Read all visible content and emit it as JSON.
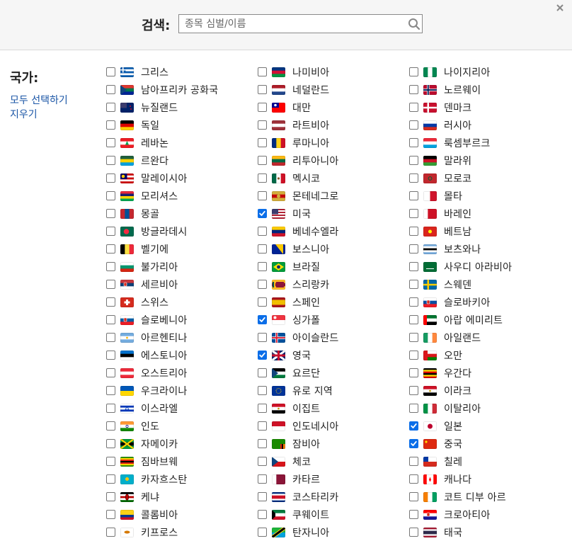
{
  "search": {
    "label": "검색:",
    "placeholder": "종목 심벌/이름",
    "value": ""
  },
  "country_panel": {
    "title": "국가:",
    "select_all": "모두 선택하기",
    "clear": "지우기"
  },
  "columns": [
    [
      {
        "name": "그리스",
        "checked": false,
        "flag": "greece"
      },
      {
        "name": "남아프리카 공화국",
        "checked": false,
        "flag": "south-africa"
      },
      {
        "name": "뉴질랜드",
        "checked": false,
        "flag": "new-zealand"
      },
      {
        "name": "독일",
        "checked": false,
        "flag": "germany"
      },
      {
        "name": "레바논",
        "checked": false,
        "flag": "lebanon"
      },
      {
        "name": "르완다",
        "checked": false,
        "flag": "rwanda"
      },
      {
        "name": "말레이시아",
        "checked": false,
        "flag": "malaysia"
      },
      {
        "name": "모리셔스",
        "checked": false,
        "flag": "mauritius"
      },
      {
        "name": "몽골",
        "checked": false,
        "flag": "mongolia"
      },
      {
        "name": "방글라데시",
        "checked": false,
        "flag": "bangladesh"
      },
      {
        "name": "벨기에",
        "checked": false,
        "flag": "belgium"
      },
      {
        "name": "불가리아",
        "checked": false,
        "flag": "bulgaria"
      },
      {
        "name": "세르비아",
        "checked": false,
        "flag": "serbia"
      },
      {
        "name": "스위스",
        "checked": false,
        "flag": "switzerland"
      },
      {
        "name": "슬로베니아",
        "checked": false,
        "flag": "slovenia"
      },
      {
        "name": "아르헨티나",
        "checked": false,
        "flag": "argentina"
      },
      {
        "name": "에스토니아",
        "checked": false,
        "flag": "estonia"
      },
      {
        "name": "오스트리아",
        "checked": false,
        "flag": "austria"
      },
      {
        "name": "우크라이나",
        "checked": false,
        "flag": "ukraine"
      },
      {
        "name": "이스라엘",
        "checked": false,
        "flag": "israel"
      },
      {
        "name": "인도",
        "checked": false,
        "flag": "india"
      },
      {
        "name": "자메이카",
        "checked": false,
        "flag": "jamaica"
      },
      {
        "name": "짐바브웨",
        "checked": false,
        "flag": "zimbabwe"
      },
      {
        "name": "카자흐스탄",
        "checked": false,
        "flag": "kazakhstan"
      },
      {
        "name": "케냐",
        "checked": false,
        "flag": "kenya"
      },
      {
        "name": "콜롬비아",
        "checked": false,
        "flag": "colombia"
      },
      {
        "name": "키프로스",
        "checked": false,
        "flag": "cyprus"
      }
    ],
    [
      {
        "name": "나미비아",
        "checked": false,
        "flag": "namibia"
      },
      {
        "name": "네덜란드",
        "checked": false,
        "flag": "netherlands"
      },
      {
        "name": "대만",
        "checked": false,
        "flag": "taiwan"
      },
      {
        "name": "라트비아",
        "checked": false,
        "flag": "latvia"
      },
      {
        "name": "루마니아",
        "checked": false,
        "flag": "romania"
      },
      {
        "name": "리투아니아",
        "checked": false,
        "flag": "lithuania"
      },
      {
        "name": "멕시코",
        "checked": false,
        "flag": "mexico"
      },
      {
        "name": "몬테네그로",
        "checked": false,
        "flag": "montenegro"
      },
      {
        "name": "미국",
        "checked": true,
        "flag": "usa"
      },
      {
        "name": "베네수엘라",
        "checked": false,
        "flag": "venezuela"
      },
      {
        "name": "보스니아",
        "checked": false,
        "flag": "bosnia"
      },
      {
        "name": "브라질",
        "checked": false,
        "flag": "brazil"
      },
      {
        "name": "스리랑카",
        "checked": false,
        "flag": "sri-lanka"
      },
      {
        "name": "스페인",
        "checked": false,
        "flag": "spain"
      },
      {
        "name": "싱가폴",
        "checked": true,
        "flag": "singapore"
      },
      {
        "name": "아이슬란드",
        "checked": false,
        "flag": "iceland"
      },
      {
        "name": "영국",
        "checked": true,
        "flag": "uk"
      },
      {
        "name": "요르단",
        "checked": false,
        "flag": "jordan"
      },
      {
        "name": "유로 지역",
        "checked": false,
        "flag": "eu"
      },
      {
        "name": "이집트",
        "checked": false,
        "flag": "egypt"
      },
      {
        "name": "인도네시아",
        "checked": false,
        "flag": "indonesia"
      },
      {
        "name": "잠비아",
        "checked": false,
        "flag": "zambia"
      },
      {
        "name": "체코",
        "checked": false,
        "flag": "czech"
      },
      {
        "name": "카타르",
        "checked": false,
        "flag": "qatar"
      },
      {
        "name": "코스타리카",
        "checked": false,
        "flag": "costa-rica"
      },
      {
        "name": "쿠웨이트",
        "checked": false,
        "flag": "kuwait"
      },
      {
        "name": "탄자니아",
        "checked": false,
        "flag": "tanzania"
      }
    ],
    [
      {
        "name": "나이지리아",
        "checked": false,
        "flag": "nigeria"
      },
      {
        "name": "노르웨이",
        "checked": false,
        "flag": "norway"
      },
      {
        "name": "덴마크",
        "checked": false,
        "flag": "denmark"
      },
      {
        "name": "러시아",
        "checked": false,
        "flag": "russia"
      },
      {
        "name": "룩셈부르크",
        "checked": false,
        "flag": "luxembourg"
      },
      {
        "name": "말라위",
        "checked": false,
        "flag": "malawi"
      },
      {
        "name": "모로코",
        "checked": false,
        "flag": "morocco"
      },
      {
        "name": "몰타",
        "checked": false,
        "flag": "malta"
      },
      {
        "name": "바레인",
        "checked": false,
        "flag": "bahrain"
      },
      {
        "name": "베트남",
        "checked": false,
        "flag": "vietnam"
      },
      {
        "name": "보츠와나",
        "checked": false,
        "flag": "botswana"
      },
      {
        "name": "사우디 아라비아",
        "checked": false,
        "flag": "saudi-arabia"
      },
      {
        "name": "스웨덴",
        "checked": false,
        "flag": "sweden"
      },
      {
        "name": "슬로바키아",
        "checked": false,
        "flag": "slovakia"
      },
      {
        "name": "아랍 에미리트",
        "checked": false,
        "flag": "uae"
      },
      {
        "name": "아일랜드",
        "checked": false,
        "flag": "ireland"
      },
      {
        "name": "오만",
        "checked": false,
        "flag": "oman"
      },
      {
        "name": "우간다",
        "checked": false,
        "flag": "uganda"
      },
      {
        "name": "이라크",
        "checked": false,
        "flag": "iraq"
      },
      {
        "name": "이탈리아",
        "checked": false,
        "flag": "italy"
      },
      {
        "name": "일본",
        "checked": true,
        "flag": "japan"
      },
      {
        "name": "중국",
        "checked": true,
        "flag": "china"
      },
      {
        "name": "칠레",
        "checked": false,
        "flag": "chile"
      },
      {
        "name": "캐나다",
        "checked": false,
        "flag": "canada"
      },
      {
        "name": "코트 디부 아르",
        "checked": false,
        "flag": "cote-divoire"
      },
      {
        "name": "크로아티아",
        "checked": false,
        "flag": "croatia"
      },
      {
        "name": "태국",
        "checked": false,
        "flag": "thailand"
      }
    ]
  ],
  "flag_colors": {
    "greece": [
      "h",
      "#0d5eaf",
      "#ffffff",
      "#0d5eaf",
      "#ffffff",
      "#0d5eaf"
    ],
    "south-africa": [
      "h",
      "#de3831",
      "#007a4d",
      "#002395"
    ],
    "new-zealand": [
      "h",
      "#012169",
      "#012169"
    ],
    "germany": [
      "h",
      "#000000",
      "#dd0000",
      "#ffce00"
    ],
    "lebanon": [
      "h",
      "#ed1c24",
      "#ffffff",
      "#ed1c24"
    ],
    "rwanda": [
      "h",
      "#20603d",
      "#fad201",
      "#00a1de"
    ],
    "malaysia": [
      "h",
      "#cc0001",
      "#ffffff",
      "#cc0001",
      "#ffffff",
      "#cc0001"
    ],
    "mauritius": [
      "h",
      "#ea2839",
      "#1a206d",
      "#ffd500",
      "#00a551"
    ],
    "mongolia": [
      "v",
      "#c4272f",
      "#015197",
      "#c4272f"
    ],
    "bangladesh": [
      "h",
      "#006a4e",
      "#006a4e"
    ],
    "belgium": [
      "v",
      "#000000",
      "#fae042",
      "#ed2939"
    ],
    "bulgaria": [
      "h",
      "#ffffff",
      "#00966e",
      "#d62612"
    ],
    "serbia": [
      "h",
      "#c6363c",
      "#0c4076",
      "#ffffff"
    ],
    "switzerland": [
      "h",
      "#d52b1e",
      "#d52b1e"
    ],
    "slovenia": [
      "h",
      "#ffffff",
      "#005da4",
      "#ed1c24"
    ],
    "argentina": [
      "h",
      "#74acdf",
      "#ffffff",
      "#74acdf"
    ],
    "estonia": [
      "h",
      "#0072ce",
      "#000000",
      "#ffffff"
    ],
    "austria": [
      "h",
      "#ed2939",
      "#ffffff",
      "#ed2939"
    ],
    "ukraine": [
      "h",
      "#0057b7",
      "#ffd700"
    ],
    "israel": [
      "h",
      "#ffffff",
      "#0038b8",
      "#ffffff",
      "#0038b8",
      "#ffffff"
    ],
    "india": [
      "h",
      "#ff9933",
      "#ffffff",
      "#138808"
    ],
    "jamaica": [
      "h",
      "#009b3a",
      "#000000",
      "#009b3a"
    ],
    "zimbabwe": [
      "h",
      "#319208",
      "#ffd200",
      "#de2010",
      "#000000",
      "#de2010",
      "#ffd200",
      "#319208"
    ],
    "kazakhstan": [
      "h",
      "#00afca",
      "#00afca"
    ],
    "kenya": [
      "h",
      "#000000",
      "#ffffff",
      "#bb0000",
      "#ffffff",
      "#006600"
    ],
    "colombia": [
      "h",
      "#fcd116",
      "#fcd116",
      "#003893",
      "#ce1126"
    ],
    "cyprus": [
      "h",
      "#ffffff",
      "#ffffff"
    ],
    "namibia": [
      "h",
      "#003580",
      "#d21034",
      "#009543"
    ],
    "netherlands": [
      "h",
      "#ae1c28",
      "#ffffff",
      "#21468b"
    ],
    "taiwan": [
      "h",
      "#fe0000",
      "#fe0000"
    ],
    "latvia": [
      "h",
      "#9e3039",
      "#ffffff",
      "#9e3039"
    ],
    "romania": [
      "v",
      "#002b7f",
      "#fcd116",
      "#ce1126"
    ],
    "lithuania": [
      "h",
      "#fdb913",
      "#006a44",
      "#c1272d"
    ],
    "mexico": [
      "v",
      "#006847",
      "#ffffff",
      "#ce1126"
    ],
    "montenegro": [
      "h",
      "#d3ae3b",
      "#c40308",
      "#d3ae3b"
    ],
    "usa": [
      "h",
      "#b22234",
      "#ffffff",
      "#b22234",
      "#ffffff",
      "#b22234",
      "#ffffff",
      "#b22234"
    ],
    "venezuela": [
      "h",
      "#ffcc00",
      "#00247d",
      "#cf142b"
    ],
    "bosnia": [
      "h",
      "#002395",
      "#002395"
    ],
    "brazil": [
      "h",
      "#009c3b",
      "#009c3b"
    ],
    "sri-lanka": [
      "h",
      "#ffbe29",
      "#8d153a",
      "#ffbe29"
    ],
    "spain": [
      "h",
      "#aa151b",
      "#f1bf00",
      "#f1bf00",
      "#aa151b"
    ],
    "singapore": [
      "h",
      "#ef3340",
      "#ffffff"
    ],
    "iceland": [
      "h",
      "#02529c",
      "#02529c"
    ],
    "uk": [
      "h",
      "#012169",
      "#012169"
    ],
    "jordan": [
      "h",
      "#000000",
      "#ffffff",
      "#007a3d"
    ],
    "eu": [
      "h",
      "#003399",
      "#003399"
    ],
    "egypt": [
      "h",
      "#ce1126",
      "#ffffff",
      "#000000"
    ],
    "indonesia": [
      "h",
      "#ce1126",
      "#ffffff"
    ],
    "zambia": [
      "h",
      "#198a00",
      "#198a00"
    ],
    "czech": [
      "h",
      "#ffffff",
      "#d7141a"
    ],
    "qatar": [
      "v",
      "#ffffff",
      "#8a1538",
      "#8a1538"
    ],
    "costa-rica": [
      "h",
      "#002b7f",
      "#ffffff",
      "#ce1126",
      "#ce1126",
      "#ffffff",
      "#002b7f"
    ],
    "kuwait": [
      "h",
      "#007a3d",
      "#ffffff",
      "#ce1126"
    ],
    "tanzania": [
      "h",
      "#1eb53a",
      "#00a3dd"
    ],
    "nigeria": [
      "v",
      "#008751",
      "#ffffff",
      "#008751"
    ],
    "norway": [
      "h",
      "#ba0c2f",
      "#ba0c2f"
    ],
    "denmark": [
      "h",
      "#c8102e",
      "#c8102e"
    ],
    "russia": [
      "h",
      "#ffffff",
      "#0039a6",
      "#d52b1e"
    ],
    "luxembourg": [
      "h",
      "#ed2939",
      "#ffffff",
      "#00a1de"
    ],
    "malawi": [
      "h",
      "#000000",
      "#ce1126",
      "#339e35"
    ],
    "morocco": [
      "h",
      "#c1272d",
      "#c1272d"
    ],
    "malta": [
      "v",
      "#ffffff",
      "#cf142b"
    ],
    "bahrain": [
      "v",
      "#ffffff",
      "#ce1126",
      "#ce1126"
    ],
    "vietnam": [
      "h",
      "#da251d",
      "#da251d"
    ],
    "botswana": [
      "h",
      "#75aadb",
      "#ffffff",
      "#000000",
      "#ffffff",
      "#75aadb"
    ],
    "saudi-arabia": [
      "h",
      "#006c35",
      "#006c35"
    ],
    "sweden": [
      "h",
      "#006aa7",
      "#006aa7"
    ],
    "slovakia": [
      "h",
      "#ffffff",
      "#0b4ea2",
      "#ee1c25"
    ],
    "uae": [
      "h",
      "#00732f",
      "#ffffff",
      "#000000"
    ],
    "ireland": [
      "v",
      "#169b62",
      "#ffffff",
      "#ff883e"
    ],
    "oman": [
      "h",
      "#ffffff",
      "#db161b",
      "#008000"
    ],
    "uganda": [
      "h",
      "#000000",
      "#fcdc04",
      "#d90000",
      "#000000",
      "#fcdc04",
      "#d90000"
    ],
    "iraq": [
      "h",
      "#ce1126",
      "#ffffff",
      "#000000"
    ],
    "italy": [
      "v",
      "#009246",
      "#ffffff",
      "#ce2b37"
    ],
    "japan": [
      "h",
      "#ffffff",
      "#ffffff"
    ],
    "china": [
      "h",
      "#de2910",
      "#de2910"
    ],
    "chile": [
      "h",
      "#ffffff",
      "#d52b1e"
    ],
    "canada": [
      "v",
      "#ff0000",
      "#ffffff",
      "#ffffff",
      "#ff0000"
    ],
    "cote-divoire": [
      "v",
      "#f77f00",
      "#ffffff",
      "#009e60"
    ],
    "croatia": [
      "h",
      "#ff0000",
      "#ffffff",
      "#171796"
    ],
    "thailand": [
      "h",
      "#a51931",
      "#f4f5f8",
      "#2d2a4a",
      "#2d2a4a",
      "#f4f5f8",
      "#a51931"
    ]
  }
}
